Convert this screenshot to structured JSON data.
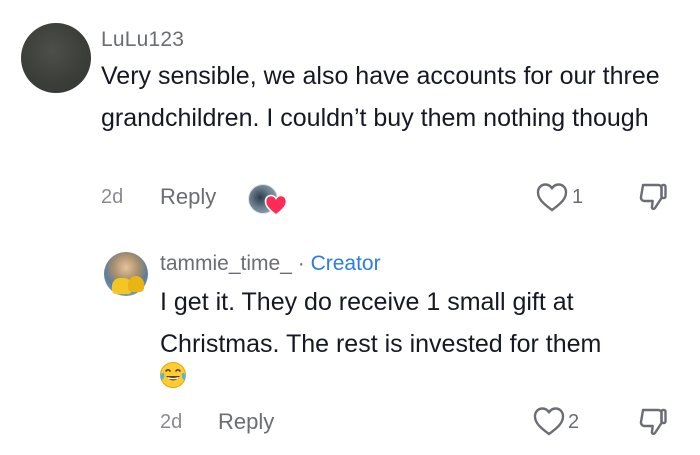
{
  "comment": {
    "username": "LuLu123",
    "text": "Very sensible, we also have accounts for our three grandchildren. I couldn’t buy them nothing though",
    "date": "2d",
    "reply_label": "Reply",
    "like_count": "1"
  },
  "reply": {
    "username": "tammie_time_",
    "separator": "·",
    "badge": "Creator",
    "text": "I get it. They do receive 1 small gift at Christmas. The rest is invested for them",
    "emoji": "😂",
    "date": "2d",
    "reply_label": "Reply",
    "like_count": "2"
  },
  "icons": {
    "like": "heart-outline-icon",
    "dislike": "thumbs-down-icon",
    "creator_liked": "red-heart-icon"
  },
  "colors": {
    "creator_badge": "#2a7de1",
    "liked_heart": "#fe2c55"
  }
}
